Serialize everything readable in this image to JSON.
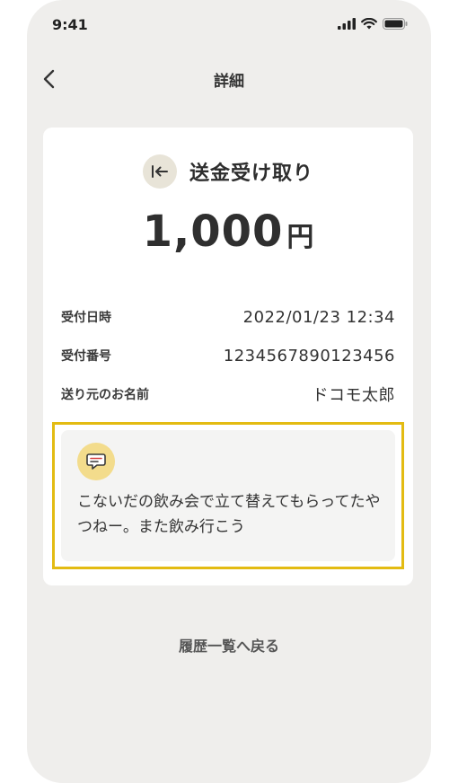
{
  "status_bar": {
    "time": "9:41"
  },
  "nav": {
    "title": "詳細"
  },
  "transaction": {
    "type": "送金受け取り",
    "amount": "1,000",
    "currency": "円",
    "details": [
      {
        "label": "受付日時",
        "value": "2022/01/23 12:34"
      },
      {
        "label": "受付番号",
        "value": "1234567890123456"
      },
      {
        "label": "送り元のお名前",
        "value": "ドコモ太郎"
      }
    ],
    "message": "こないだの飲み会で立て替えてもらってたやつねー。また飲み行こう"
  },
  "footer": {
    "history_link": "履歴一覧へ戻る"
  },
  "colors": {
    "highlight": "#e3bb12",
    "background": "#efeeec",
    "card": "#ffffff"
  }
}
